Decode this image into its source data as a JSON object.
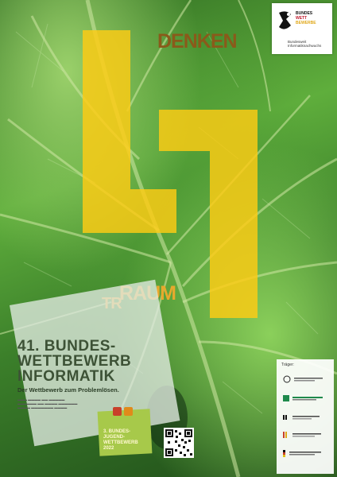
{
  "poster": {
    "word_denken": "DENKEN",
    "word_raum": "RAUM",
    "word_tr": "TR",
    "logo": {
      "lines": [
        "BUNDES",
        "WETT",
        "BEWERBE"
      ],
      "subtitle": "Bundesweit Informatiknachwuchs"
    },
    "competition": {
      "title_lines": [
        "41. BUNDES-",
        "WETTBEWERB",
        "INFORMATIK"
      ],
      "tagline": "Der Wettbewerb zum Problemlösen."
    },
    "junior": {
      "lines": [
        "3. BUNDES-",
        "JUGEND-",
        "WETTBEWERB",
        "2022"
      ]
    },
    "sponsors": {
      "label": "Träger:"
    },
    "colors": {
      "yellow": "#ffcc14",
      "leaf_green": "#4f9a35",
      "dark_green": "#1f4c19",
      "junior_green": "#a7c94a"
    }
  }
}
